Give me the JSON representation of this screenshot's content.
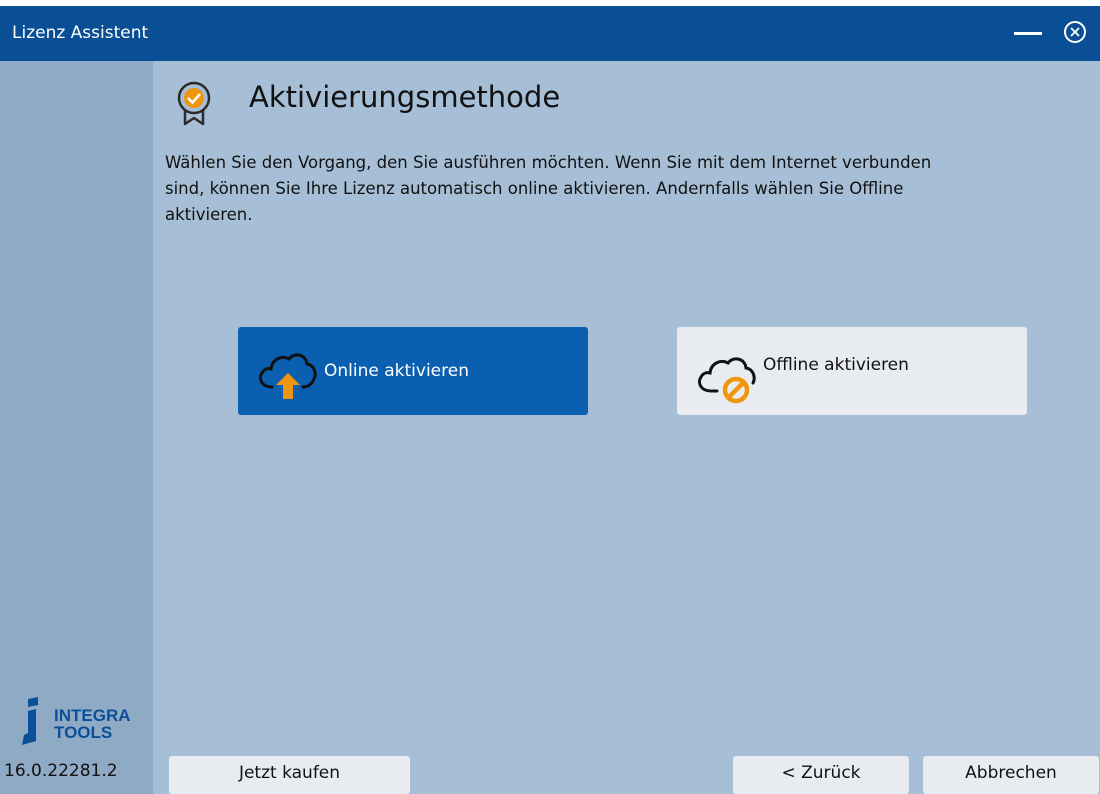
{
  "window": {
    "title": "Lizenz Assistent"
  },
  "sidebar": {
    "brand_line1": "INTEGRA",
    "brand_line2": "TOOLS",
    "version": "16.0.22281.2"
  },
  "main": {
    "heading": "Aktivierungsmethode",
    "description": "Wählen Sie den Vorgang, den Sie ausführen möchten. Wenn Sie mit dem Internet verbunden sind, können Sie Ihre Lizenz automatisch online aktivieren. Andernfalls wählen Sie Offline aktivieren.",
    "options": {
      "online_label": "Online aktivieren",
      "offline_label": "Offline aktivieren"
    }
  },
  "footer": {
    "buy_label": "Jetzt kaufen",
    "back_label": "< Zurück",
    "cancel_label": "Abbrechen"
  },
  "colors": {
    "titlebar": "#0a4f96",
    "background": "#a6bfd6",
    "sidebar": "#8faac4",
    "primary_button": "#0b5fb0",
    "accent": "#f0960e"
  },
  "icons": {
    "header": "award-badge-icon",
    "online": "cloud-upload-icon",
    "offline": "cloud-blocked-icon",
    "close": "close-circle-icon",
    "minimize": "minimize-icon"
  }
}
